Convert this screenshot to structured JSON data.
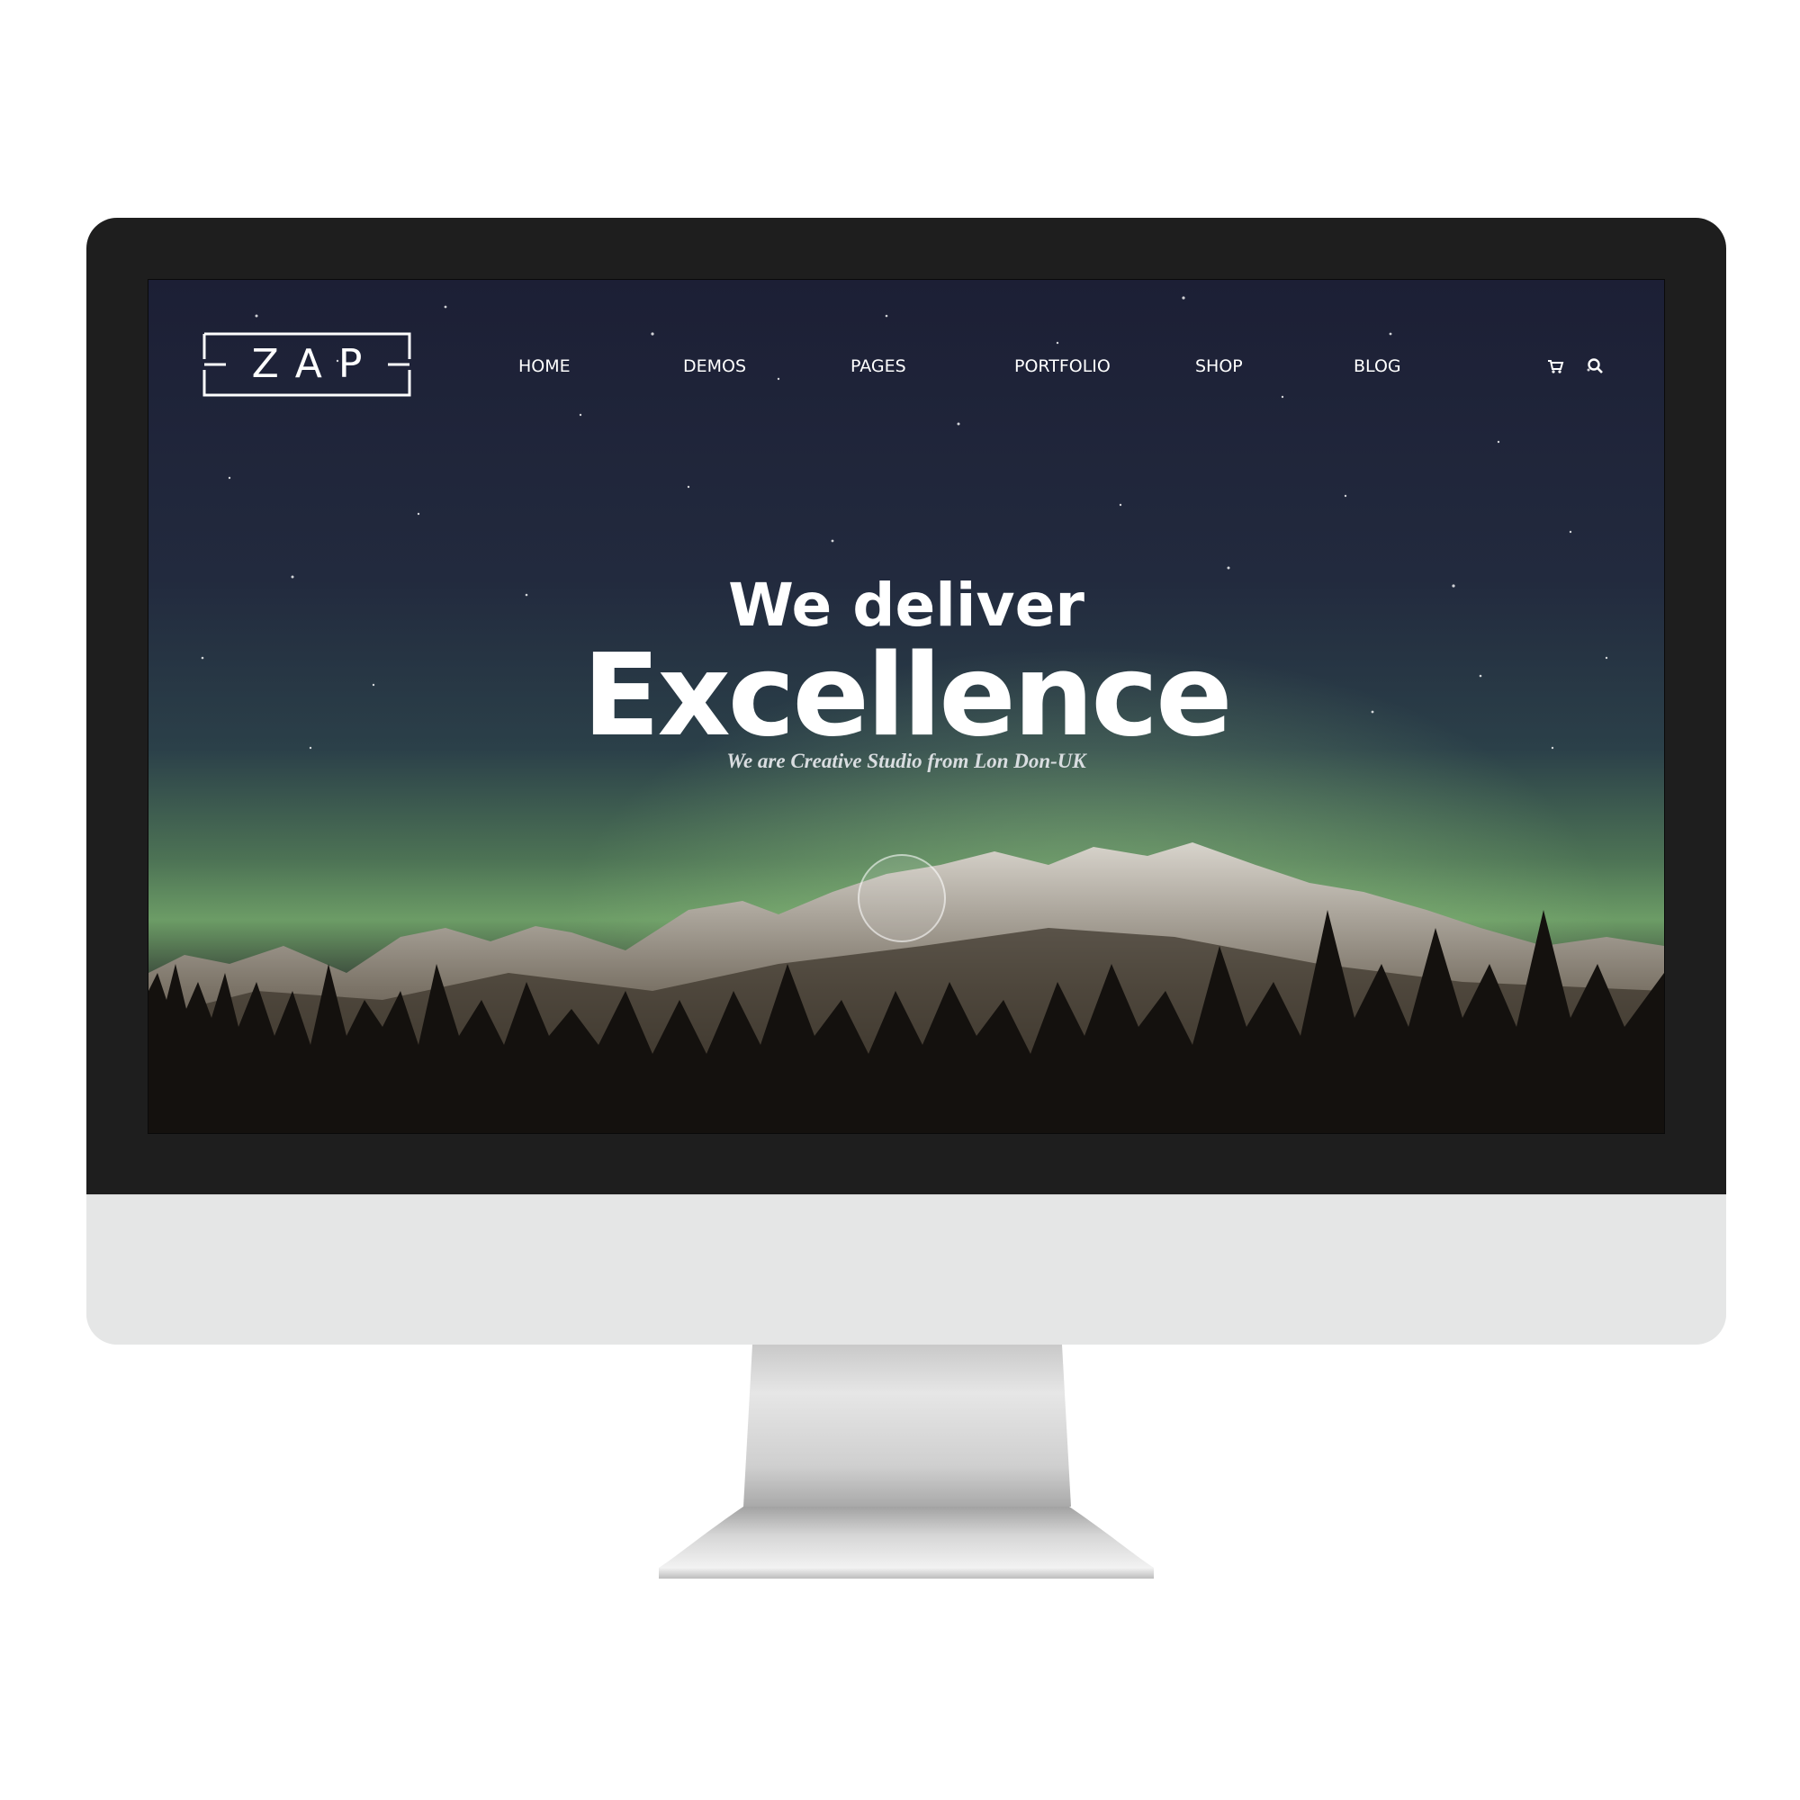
{
  "site": {
    "logo_text": "ZAP"
  },
  "nav": {
    "items": [
      {
        "label": "HOME"
      },
      {
        "label": "DEMOS"
      },
      {
        "label": "PAGES"
      },
      {
        "label": "PORTFOLIO"
      },
      {
        "label": "SHOP"
      },
      {
        "label": "BLOG"
      }
    ],
    "icons": [
      "cart-icon",
      "search-icon"
    ]
  },
  "hero": {
    "line1": "We deliver",
    "line2": "Excellence",
    "subtitle": "We are Creative Studio from Lon Don-UK"
  },
  "colors": {
    "bezel": "#1e1e1e",
    "chin": "#e5e6e6",
    "sky_top": "#1c2036",
    "aurora": "#7fbf7a",
    "text": "#ffffff"
  }
}
